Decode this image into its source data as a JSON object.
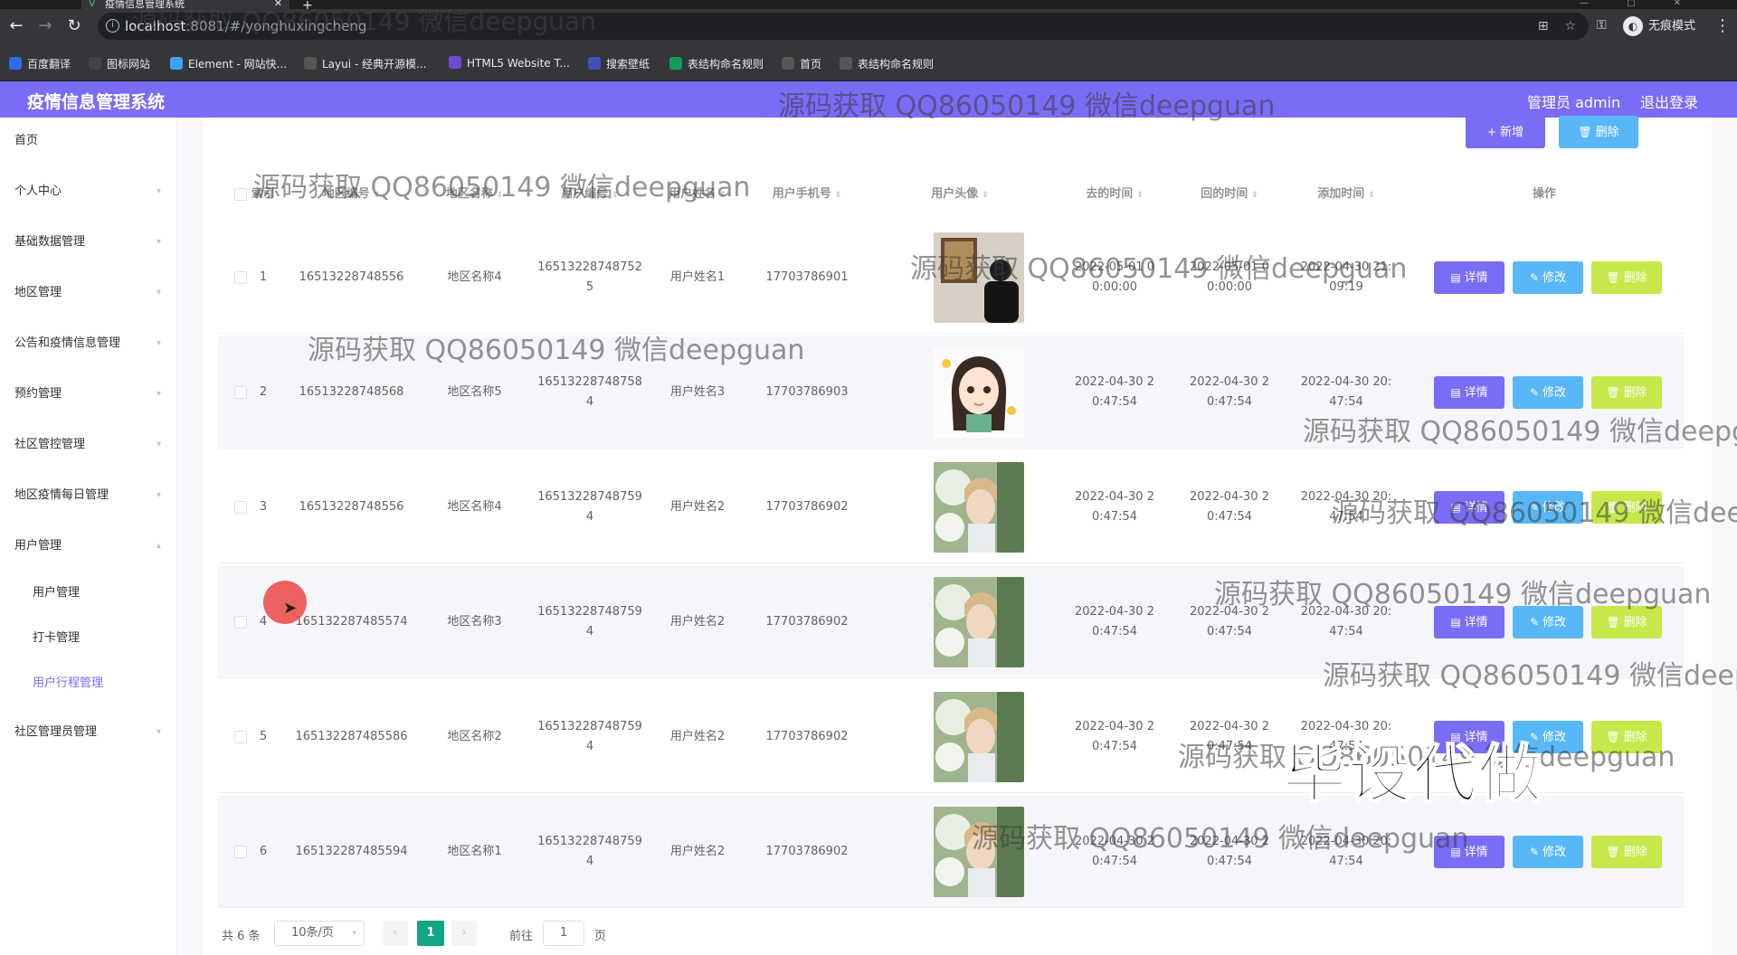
{
  "browser": {
    "tab_title": "疫情信息管理系统",
    "new_tab": "+",
    "url_host": "localhost",
    "url_rest": ":8081/#/yonghuxingcheng",
    "incognito_label": "无痕模式",
    "bookmarks": [
      {
        "label": "百度翻译",
        "color": "#2b6de8"
      },
      {
        "label": "图标网站",
        "color": "#444444"
      },
      {
        "label": "Element - 网站快...",
        "color": "#409eff"
      },
      {
        "label": "Layui - 经典开源模...",
        "color": "#555555"
      },
      {
        "label": "HTML5 Website T...",
        "color": "#6c4cd3"
      },
      {
        "label": "搜索壁纸",
        "color": "#3f51b5"
      },
      {
        "label": "表结构命名规则",
        "color": "#0f9d58"
      },
      {
        "label": "首页",
        "color": "#555555"
      },
      {
        "label": "表结构命名规则",
        "color": "#555555"
      }
    ]
  },
  "app": {
    "title": "疫情信息管理系统",
    "admin_label": "管理员 admin",
    "logout_label": "退出登录",
    "brand_color": "#7b6cf6"
  },
  "sidebar": {
    "items": [
      {
        "label": "首页",
        "has_arrow": false
      },
      {
        "label": "个人中心",
        "has_arrow": true
      },
      {
        "label": "基础数据管理",
        "has_arrow": true
      },
      {
        "label": "地区管理",
        "has_arrow": true
      },
      {
        "label": "公告和疫情信息管理",
        "has_arrow": true
      },
      {
        "label": "预约管理",
        "has_arrow": true
      },
      {
        "label": "社区管控管理",
        "has_arrow": true
      },
      {
        "label": "地区疫情每日管理",
        "has_arrow": true
      },
      {
        "label": "用户管理",
        "has_arrow": true
      },
      {
        "label": "用户管理",
        "sub": true
      },
      {
        "label": "打卡管理",
        "sub": true
      },
      {
        "label": "用户行程管理",
        "sub": true,
        "active": true
      },
      {
        "label": "社区管理员管理",
        "has_arrow": true
      }
    ]
  },
  "toolbar": {
    "add_label": "新增",
    "delete_label": "删除"
  },
  "table": {
    "columns": [
      "索引",
      "地区编号",
      "地区名称",
      "用户编号",
      "用户姓名",
      "用户手机号",
      "用户头像",
      "去的时间",
      "回的时间",
      "添加时间",
      "操作"
    ],
    "row_actions": {
      "detail": "详情",
      "edit": "修改",
      "delete": "删除"
    },
    "rows": [
      {
        "index": "1",
        "region_no": "16513228748556",
        "region_name": "地区名称4",
        "user_no": "165132287487525",
        "user_name": "用户姓名1",
        "phone": "17703786901",
        "avatar": "photo-man",
        "go_time": "2022-05-01 00:00:00",
        "back_time": "2022-05-01 00:00:00",
        "add_time": "2022-04-30 21:09:19"
      },
      {
        "index": "2",
        "region_no": "16513228748568",
        "region_name": "地区名称5",
        "user_no": "165132287487584",
        "user_name": "用户姓名3",
        "phone": "17703786903",
        "avatar": "cartoon-girl",
        "go_time": "2022-04-30 20:47:54",
        "back_time": "2022-04-30 20:47:54",
        "add_time": "2022-04-30 20:47:54"
      },
      {
        "index": "3",
        "region_no": "16513228748556",
        "region_name": "地区名称4",
        "user_no": "165132287487594",
        "user_name": "用户姓名2",
        "phone": "17703786902",
        "avatar": "photo-boy",
        "go_time": "2022-04-30 20:47:54",
        "back_time": "2022-04-30 20:47:54",
        "add_time": "2022-04-30 20:47:54"
      },
      {
        "index": "4",
        "region_no": "165132287485574",
        "region_name": "地区名称3",
        "user_no": "165132287487594",
        "user_name": "用户姓名2",
        "phone": "17703786902",
        "avatar": "photo-boy",
        "go_time": "2022-04-30 20:47:54",
        "back_time": "2022-04-30 20:47:54",
        "add_time": "2022-04-30 20:47:54"
      },
      {
        "index": "5",
        "region_no": "165132287485586",
        "region_name": "地区名称2",
        "user_no": "165132287487594",
        "user_name": "用户姓名2",
        "phone": "17703786902",
        "avatar": "photo-boy",
        "go_time": "2022-04-30 20:47:54",
        "back_time": "2022-04-30 20:47:54",
        "add_time": "2022-04-30 20:47:54"
      },
      {
        "index": "6",
        "region_no": "165132287485594",
        "region_name": "地区名称1",
        "user_no": "165132287487594",
        "user_name": "用户姓名2",
        "phone": "17703786902",
        "avatar": "photo-boy",
        "go_time": "2022-04-30 20:47:54",
        "back_time": "2022-04-30 20:47:54",
        "add_time": "2022-04-30 20:47:54"
      }
    ]
  },
  "pagination": {
    "total_label": "共 6 条",
    "page_size": "10条/页",
    "current_page": "1",
    "goto_label": "前往",
    "goto_value": "1",
    "page_suffix": "页"
  },
  "overlays": {
    "watermark": "源码获取 QQ86050149 微信deepguan",
    "watermark_cut": "源码获取 QQ86050149 微信deepg",
    "big_text": "毕设代做"
  }
}
